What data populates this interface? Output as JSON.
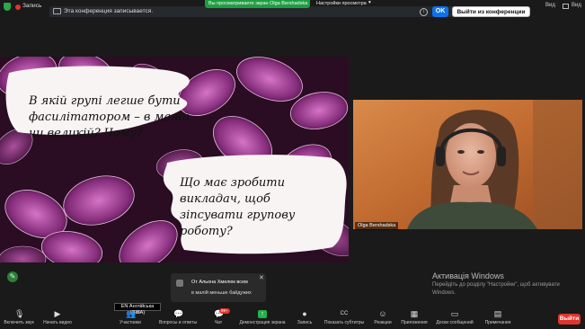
{
  "topbar": {
    "rec_label": "Запись",
    "notice_text": "Эта конференция записывается.",
    "banner_text": "Вы просматриваете экран Olga Bershadska",
    "view_options_label": "Настройки просмотра",
    "ok_label": "OK",
    "leave_label": "Выйти из конференции",
    "view_label": "Вид",
    "info_glyph": "i",
    "view_chevron_glyph": "▾"
  },
  "slide": {
    "question1": "В якій групі легше бути фасилітатором – в малій чи великій? Чому?",
    "question2": "Що має зробити викладач, щоб зіпсувати групову роботу?"
  },
  "video": {
    "participant_name": "Olga Bershadska"
  },
  "windows_watermark": {
    "title": "Активація Windows",
    "subtitle": "Перейдіть до розділу \"Настройки\", щоб активувати Windows."
  },
  "chat_toast": {
    "from": "От Альона Хмелюк всем",
    "message": "в малій меньше байдужих",
    "close_glyph": "✕"
  },
  "toolbar": {
    "language_tooltip": "EN Англійська (США)",
    "participants_count": "196",
    "chat_badge": "99+",
    "items": [
      {
        "label": "Включить звук",
        "icon": "mic-muted-icon",
        "glyph": "🎙"
      },
      {
        "label": "Начать видео",
        "icon": "video-off-icon",
        "glyph": "▶"
      },
      {
        "label": "Участники",
        "icon": "participants-icon",
        "glyph": "👥"
      },
      {
        "label": "Вопросы и ответы",
        "icon": "qa-icon",
        "glyph": "💬"
      },
      {
        "label": "Чат",
        "icon": "chat-icon",
        "glyph": "💬"
      },
      {
        "label": "Демонстрация экрана",
        "icon": "share-screen-icon",
        "glyph": "↑"
      },
      {
        "label": "Запись",
        "icon": "record-icon",
        "glyph": "●"
      },
      {
        "label": "Показать субтитры",
        "icon": "captions-icon",
        "glyph": "CC"
      },
      {
        "label": "Реакции",
        "icon": "reactions-icon",
        "glyph": "☺"
      },
      {
        "label": "Приложения",
        "icon": "apps-icon",
        "glyph": "▦"
      },
      {
        "label": "Доски сообщений",
        "icon": "whiteboard-icon",
        "glyph": "▭"
      },
      {
        "label": "Примечания",
        "icon": "notes-icon",
        "glyph": "▤"
      }
    ],
    "leave_label": "Выйти"
  },
  "colors": {
    "accent_blue": "#0e72ed",
    "share_green": "#22b14c",
    "danger_red": "#e0352b",
    "background": "#1a1a1a"
  }
}
